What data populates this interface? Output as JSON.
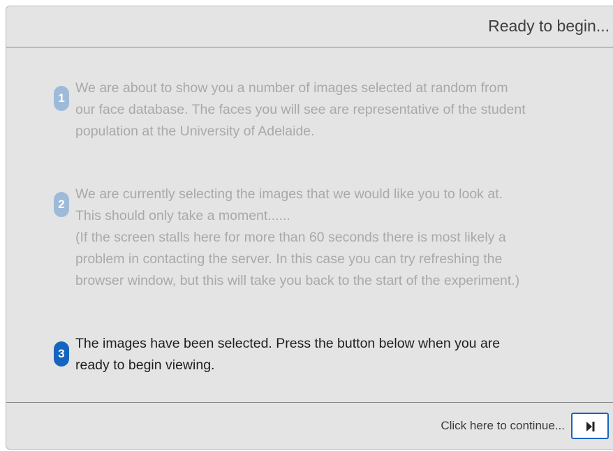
{
  "header": {
    "title": "Ready to begin..."
  },
  "steps": [
    {
      "number": "1",
      "state": "inactive",
      "lines": [
        "We are about to show you a number of images selected at random from",
        "our face database. The faces you will see are representative of the student",
        "population at the University of Adelaide."
      ]
    },
    {
      "number": "2",
      "state": "inactive",
      "lines": [
        "We are currently selecting the images that we would like you to look at.",
        "This should only take a moment......",
        "(If the screen stalls here for more than 60 seconds there is most likely a",
        "problem in contacting the server. In this case you can try refreshing the",
        "browser window, but this will take you back to the start of the experiment.)"
      ]
    },
    {
      "number": "3",
      "state": "active",
      "lines": [
        "The images have been selected. Press the button below when you are",
        "ready to begin viewing."
      ]
    }
  ],
  "footer": {
    "continue_label": "Click here to continue...",
    "continue_button_icon": "play-pause-icon"
  },
  "colors": {
    "active_accent": "#1565c0",
    "inactive_badge": "#9dbbd9",
    "inactive_text": "#a9a9a9",
    "panel_background": "#e4e4e4"
  }
}
